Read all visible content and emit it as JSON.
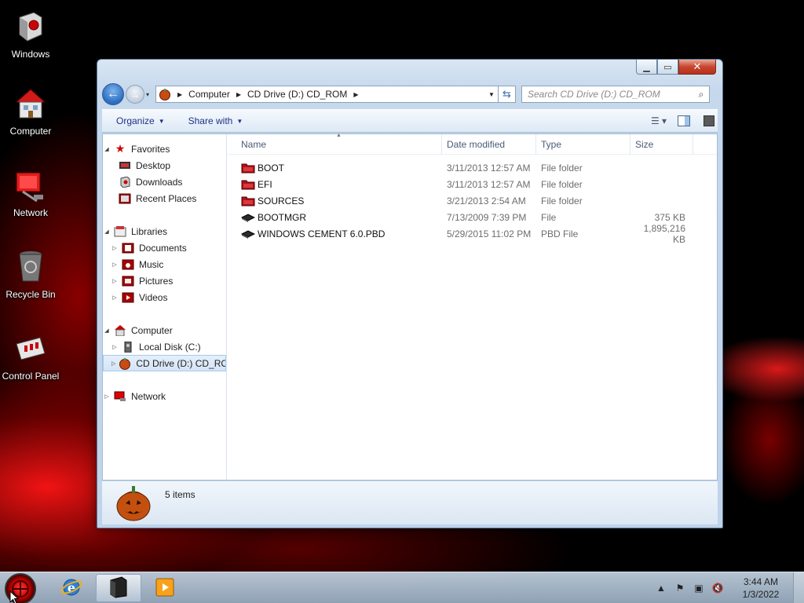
{
  "desktop": {
    "icons": [
      {
        "label": "Windows",
        "icon": "windows-explorer-icon"
      },
      {
        "label": "Computer",
        "icon": "computer-icon"
      },
      {
        "label": "Network",
        "icon": "network-icon"
      },
      {
        "label": "Recycle Bin",
        "icon": "recycle-bin-icon"
      },
      {
        "label": "Control Panel",
        "icon": "control-panel-icon"
      }
    ]
  },
  "window": {
    "address": {
      "segments": [
        "Computer",
        "CD Drive (D:) CD_ROM"
      ]
    },
    "search": {
      "placeholder": "Search CD Drive (D:) CD_ROM"
    },
    "toolbar": {
      "organize": "Organize",
      "share_with": "Share with"
    },
    "nav": {
      "favorites": {
        "label": "Favorites",
        "items": [
          "Desktop",
          "Downloads",
          "Recent Places"
        ]
      },
      "libraries": {
        "label": "Libraries",
        "items": [
          "Documents",
          "Music",
          "Pictures",
          "Videos"
        ]
      },
      "computer": {
        "label": "Computer",
        "items": [
          "Local Disk (C:)",
          "CD Drive (D:) CD_ROM"
        ]
      },
      "network": {
        "label": "Network"
      }
    },
    "columns": {
      "name": "Name",
      "date": "Date modified",
      "type": "Type",
      "size": "Size"
    },
    "files": [
      {
        "name": "BOOT",
        "date": "3/11/2013 12:57 AM",
        "type": "File folder",
        "size": "",
        "kind": "folder"
      },
      {
        "name": "EFI",
        "date": "3/11/2013 12:57 AM",
        "type": "File folder",
        "size": "",
        "kind": "folder"
      },
      {
        "name": "SOURCES",
        "date": "3/21/2013 2:54 AM",
        "type": "File folder",
        "size": "",
        "kind": "folder"
      },
      {
        "name": "BOOTMGR",
        "date": "7/13/2009 7:39 PM",
        "type": "File",
        "size": "375 KB",
        "kind": "file"
      },
      {
        "name": "WINDOWS CEMENT 6.0.PBD",
        "date": "5/29/2015 11:02 PM",
        "type": "PBD File",
        "size": "1,895,216 KB",
        "kind": "file"
      }
    ],
    "status": {
      "item_count": "5 items"
    }
  },
  "taskbar": {
    "clock_time": "3:44 AM",
    "clock_date": "1/3/2022"
  },
  "colors": {
    "accent": "#cc0000",
    "link_blue": "#1e3287"
  }
}
